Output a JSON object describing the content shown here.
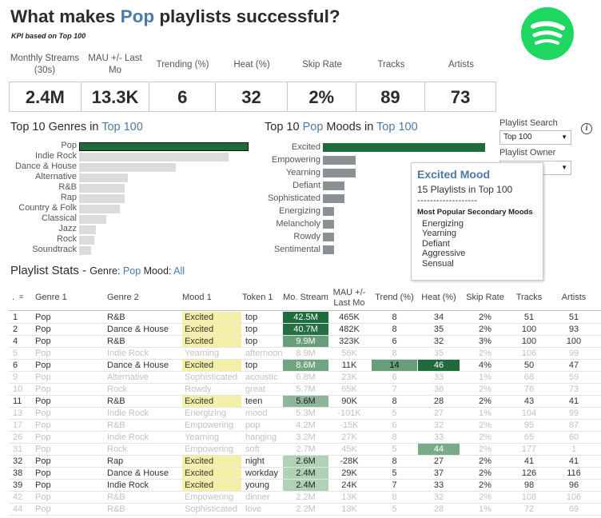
{
  "header": {
    "title_pre": "What makes ",
    "title_hl": "Pop",
    "title_post": " playlists successful?",
    "subtitle": "KPI based on Top 100"
  },
  "logo": {
    "icon": "spotify-logo",
    "color": "#1ed760"
  },
  "kpis": [
    {
      "label": "Monthly Streams (30s)",
      "value": "2.4M"
    },
    {
      "label": "MAU +/- Last Mo",
      "value": "13.3K"
    },
    {
      "label": "Trending (%)",
      "value": "6"
    },
    {
      "label": "Heat (%)",
      "value": "32"
    },
    {
      "label": "Skip Rate",
      "value": "2%"
    },
    {
      "label": "Tracks",
      "value": "89"
    },
    {
      "label": "Artists",
      "value": "73"
    }
  ],
  "genres_chart": {
    "title_pre": "Top 10 Genres in ",
    "title_hl": "Top 100",
    "items": [
      {
        "label": "Pop",
        "value": 100,
        "highlight": true
      },
      {
        "label": "Indie Rock",
        "value": 88
      },
      {
        "label": "Dance & House",
        "value": 57
      },
      {
        "label": "Alternative",
        "value": 29
      },
      {
        "label": "R&B",
        "value": 27
      },
      {
        "label": "Rap",
        "value": 27
      },
      {
        "label": "Country & Folk",
        "value": 24
      },
      {
        "label": "Classical",
        "value": 16
      },
      {
        "label": "Jazz",
        "value": 10
      },
      {
        "label": "Rock",
        "value": 9
      },
      {
        "label": "Soundtrack",
        "value": 7
      }
    ]
  },
  "moods_chart": {
    "title_pre": "Top 10 ",
    "title_hl1": "Pop",
    "title_mid": " Moods in ",
    "title_hl2": "Top 100",
    "items": [
      {
        "label": "Excited",
        "value": 15,
        "highlight": true
      },
      {
        "label": "Empowering",
        "value": 3
      },
      {
        "label": "Yearning",
        "value": 3
      },
      {
        "label": "Defiant",
        "value": 2
      },
      {
        "label": "Sophisticated",
        "value": 2
      },
      {
        "label": "Energizing",
        "value": 1
      },
      {
        "label": "Melancholy",
        "value": 1
      },
      {
        "label": "Rowdy",
        "value": 1
      },
      {
        "label": "Sentimental",
        "value": 1
      }
    ]
  },
  "controls": {
    "search_label": "Playlist Search",
    "search_value": "Top 100",
    "owner_label": "Playlist Owner"
  },
  "tooltip": {
    "title": "Excited Mood",
    "subtitle": "15 Playlists in Top 100",
    "dashes": "-------------------",
    "heading": "Most Popular Secondary Moods",
    "moods": [
      "Energizing",
      "Yearning",
      "Defiant",
      "Aggressive",
      "Sensual"
    ]
  },
  "stats": {
    "title": "Playlist Stats",
    "sep": " - ",
    "genre_label": "Genre: ",
    "genre_value": "Pop",
    "mood_label": " Mood: ",
    "mood_value": "All",
    "sort_icon": "sort-icon",
    "columns": [
      ".",
      "Genre 1",
      "Genre 2",
      "Mood 1",
      "Token 1",
      "Mo. Stream",
      "MAU +/- Last Mo",
      "Trend (%)",
      "Heat (%)",
      "Skip Rate",
      "Tracks",
      "Artists"
    ],
    "rows": [
      {
        "rank": "1",
        "g1": "Pop",
        "g2": "R&B",
        "mood": "Excited",
        "token": "top",
        "stream": "42.5M",
        "stream_level": 1.0,
        "mau": "465K",
        "trend": "8",
        "heat": "34",
        "skip": "2%",
        "tracks": "51",
        "artists": "51",
        "dim": false
      },
      {
        "rank": "2",
        "g1": "Pop",
        "g2": "Dance & House",
        "mood": "Excited",
        "token": "top",
        "stream": "40.7M",
        "stream_level": 0.96,
        "mau": "482K",
        "trend": "8",
        "heat": "35",
        "skip": "2%",
        "tracks": "100",
        "artists": "93",
        "dim": false
      },
      {
        "rank": "4",
        "g1": "Pop",
        "g2": "R&B",
        "mood": "Excited",
        "token": "top",
        "stream": "9.9M",
        "stream_level": 0.6,
        "mau": "323K",
        "trend": "6",
        "heat": "32",
        "skip": "3%",
        "tracks": "100",
        "artists": "100",
        "dim": false
      },
      {
        "rank": "5",
        "g1": "Pop",
        "g2": "Indie Rock",
        "mood": "Yearning",
        "token": "afternoon",
        "stream": "8.9M",
        "stream_level": 0.55,
        "mau": "56K",
        "trend": "8",
        "heat": "35",
        "skip": "2%",
        "tracks": "106",
        "artists": "99",
        "dim": true
      },
      {
        "rank": "6",
        "g1": "Pop",
        "g2": "Dance & House",
        "mood": "Excited",
        "token": "top",
        "stream": "8.6M",
        "stream_level": 0.55,
        "mau": "11K",
        "trend": "14",
        "trend_level": 0.6,
        "heat": "46",
        "heat_level": 1.0,
        "skip": "4%",
        "tracks": "50",
        "artists": "47",
        "dim": false
      },
      {
        "rank": "9",
        "g1": "Pop",
        "g2": "Alternative",
        "mood": "Sophisticated",
        "token": "acoustic",
        "stream": "6.8M",
        "stream_level": 0.45,
        "mau": "23K",
        "trend": "6",
        "heat": "33",
        "skip": "1%",
        "tracks": "68",
        "artists": "59",
        "dim": true
      },
      {
        "rank": "10",
        "g1": "Pop",
        "g2": "Rock",
        "mood": "Rowdy",
        "token": "great",
        "stream": "5.7M",
        "stream_level": 0.4,
        "mau": "65K",
        "trend": "7",
        "heat": "36",
        "skip": "2%",
        "tracks": "76",
        "artists": "73",
        "dim": true
      },
      {
        "rank": "11",
        "g1": "Pop",
        "g2": "R&B",
        "mood": "Excited",
        "token": "teen",
        "stream": "5.6M",
        "stream_level": 0.4,
        "mau": "90K",
        "trend": "8",
        "heat": "28",
        "skip": "2%",
        "tracks": "43",
        "artists": "41",
        "dim": false
      },
      {
        "rank": "13",
        "g1": "Pop",
        "g2": "Indie Rock",
        "mood": "Energizing",
        "token": "mood",
        "stream": "5.3M",
        "stream_level": 0.35,
        "mau": "-101K",
        "trend": "5",
        "heat": "27",
        "skip": "1%",
        "tracks": "104",
        "artists": "99",
        "dim": true
      },
      {
        "rank": "17",
        "g1": "Pop",
        "g2": "R&B",
        "mood": "Empowering",
        "token": "pop",
        "stream": "4.2M",
        "stream_level": 0.3,
        "mau": "-15K",
        "trend": "6",
        "heat": "32",
        "skip": "2%",
        "tracks": "95",
        "artists": "87",
        "dim": true
      },
      {
        "rank": "26",
        "g1": "Pop",
        "g2": "Indie Rock",
        "mood": "Yearning",
        "token": "hanging",
        "stream": "3.2M",
        "stream_level": 0.25,
        "mau": "27K",
        "trend": "8",
        "heat": "33",
        "skip": "2%",
        "tracks": "65",
        "artists": "60",
        "dim": true
      },
      {
        "rank": "31",
        "g1": "Pop",
        "g2": "Rock",
        "mood": "Empowering",
        "token": "soft",
        "stream": "2.7M",
        "stream_level": 0.2,
        "mau": "45K",
        "trend": "5",
        "heat": "44",
        "heat_level": 0.5,
        "skip": "2%",
        "tracks": "177",
        "artists": "1",
        "dim": true
      },
      {
        "rank": "32",
        "g1": "Pop",
        "g2": "Rap",
        "mood": "Excited",
        "token": "night",
        "stream": "2.6M",
        "stream_level": 0.2,
        "mau": "-28K",
        "trend": "8",
        "heat": "27",
        "skip": "2%",
        "tracks": "41",
        "artists": "41",
        "dim": false
      },
      {
        "rank": "38",
        "g1": "Pop",
        "g2": "Dance & House",
        "mood": "Excited",
        "token": "workday",
        "stream": "2.4M",
        "stream_level": 0.2,
        "mau": "29K",
        "trend": "5",
        "heat": "37",
        "skip": "2%",
        "tracks": "126",
        "artists": "116",
        "dim": false
      },
      {
        "rank": "39",
        "g1": "Pop",
        "g2": "Indie Rock",
        "mood": "Excited",
        "token": "young",
        "stream": "2.4M",
        "stream_level": 0.2,
        "mau": "24K",
        "trend": "7",
        "heat": "33",
        "skip": "2%",
        "tracks": "98",
        "artists": "96",
        "dim": false
      },
      {
        "rank": "42",
        "g1": "Pop",
        "g2": "R&B",
        "mood": "Empowering",
        "token": "dinner",
        "stream": "2.2M",
        "stream_level": 0.18,
        "mau": "13K",
        "trend": "8",
        "heat": "32",
        "skip": "2%",
        "tracks": "108",
        "artists": "106",
        "dim": true
      },
      {
        "rank": "44",
        "g1": "Pop",
        "g2": "R&B",
        "mood": "Sophisticated",
        "token": "love",
        "stream": "2.2M",
        "stream_level": 0.18,
        "mau": "13K",
        "trend": "5",
        "heat": "28",
        "skip": "1%",
        "tracks": "72",
        "artists": "69",
        "dim": true
      }
    ]
  },
  "colors": {
    "accent": "#4e79a7",
    "dark_green": "#1e6b3c",
    "mood_highlight": "#f4f0a8",
    "gray_bar": "#dcdcdc",
    "mood_bar": "#8b9094"
  }
}
